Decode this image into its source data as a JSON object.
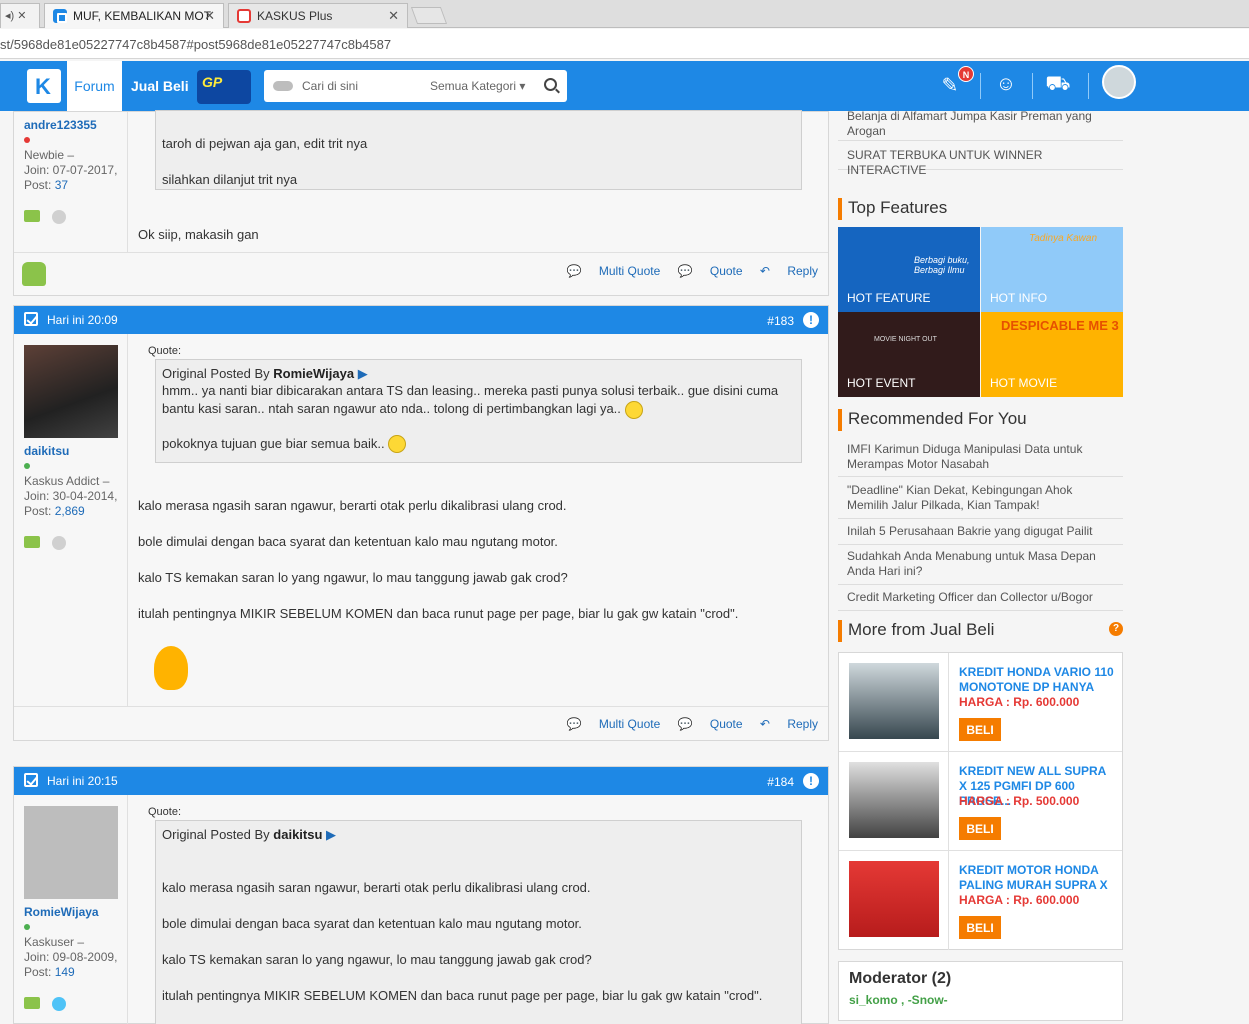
{
  "browser": {
    "tabs": [
      {
        "label": "MUF, KEMBALIKAN MOT"
      },
      {
        "label": "KASKUS Plus"
      }
    ],
    "stub": "◂) ✕",
    "url": "st/5968de81e05227747c8b4587#post5968de81e05227747c8b4587"
  },
  "header": {
    "nav_forum": "Forum",
    "nav_jualbeli": "Jual Beli",
    "gp": "GP",
    "search_placeholder": "Cari di sini",
    "search_category": "Semua Kategori",
    "notif_badge": "N"
  },
  "posts": {
    "p182": {
      "user": {
        "name": "andre123355",
        "rank": "Newbie –",
        "join": "Join: 07-07-2017,",
        "post_label": "Post: ",
        "post_count": "37"
      },
      "quote_lines": [
        "taroh di pejwan aja gan, edit trit nya",
        "silahkan dilanjut trit nya"
      ],
      "body": "Ok siip, makasih gan"
    },
    "p183": {
      "date": "Hari ini 20:09",
      "number": "#183",
      "user": {
        "name": "daikitsu",
        "rank": "Kaskus Addict –",
        "join": "Join: 30-04-2014,",
        "post_label": "Post: ",
        "post_count": "2,869"
      },
      "quote_label": "Quote:",
      "quote_prefix": "Original Posted By ",
      "quote_author": "RomieWijaya",
      "quote_text1": "hmm.. ya nanti biar dibicarakan antara TS dan leasing.. mereka pasti punya solusi terbaik.. gue disini cuma bantu kasi saran.. ntah saran ngawur ato nda.. tolong di pertimbangkan lagi ya..",
      "quote_text2": "pokoknya tujuan gue biar semua baik..",
      "body": [
        "kalo merasa ngasih saran ngawur, berarti otak perlu dikalibrasi ulang crod.",
        "bole dimulai dengan baca syarat dan ketentuan kalo mau ngutang motor.",
        "kalo TS kemakan saran lo yang ngawur, lo mau tanggung jawab gak crod?",
        "itulah pentingnya MIKIR SEBELUM KOMEN dan baca runut page per page, biar lu gak gw katain \"crod\"."
      ]
    },
    "p184": {
      "date": "Hari ini 20:15",
      "number": "#184",
      "user": {
        "name": "RomieWijaya",
        "rank": "Kaskuser –",
        "join": "Join: 09-08-2009,",
        "post_label": "Post: ",
        "post_count": "149"
      },
      "quote_label": "Quote:",
      "quote_prefix": "Original Posted By ",
      "quote_author": "daikitsu",
      "quote_lines": [
        "kalo merasa ngasih saran ngawur, berarti otak perlu dikalibrasi ulang crod.",
        "bole dimulai dengan baca syarat dan ketentuan kalo mau ngutang motor.",
        "kalo TS kemakan saran lo yang ngawur, lo mau tanggung jawab gak crod?",
        "itulah pentingnya MIKIR SEBELUM KOMEN dan baca runut page per page, biar lu gak gw katain \"crod\"."
      ]
    }
  },
  "actions": {
    "multi_quote": "Multi Quote",
    "quote": "Quote",
    "reply": "Reply"
  },
  "sidebar": {
    "top_links": [
      "Belanja di Alfamart Jumpa Kasir Preman yang Arogan",
      "SURAT TERBUKA UNTUK WINNER INTERACTIVE"
    ],
    "top_features_title": "Top Features",
    "features": [
      {
        "label": "HOT FEATURE",
        "art": "Berbagi buku, Berbagi Ilmu",
        "color": "#1565c0"
      },
      {
        "label": "HOT INFO",
        "art": "Tadinya Kawan",
        "color": "#90caf9"
      },
      {
        "label": "HOT EVENT",
        "art": "MOVIE NIGHT OUT",
        "color": "#311b1b"
      },
      {
        "label": "HOT MOVIE",
        "art": "DESPICABLE ME 3",
        "color": "#ffb300"
      }
    ],
    "recommended_title": "Recommended For You",
    "recommended": [
      "IMFI Karimun Diduga Manipulasi Data untuk Merampas Motor Nasabah",
      "\"Deadline\" Kian Dekat, Kebingungan Ahok Memilih Jalur Pilkada, Kian Tampak!",
      "Inilah 5 Perusahaan Bakrie yang digugat Pailit",
      "Sudahkah Anda Menabung untuk Masa Depan Anda Hari ini?",
      "Credit Marketing Officer dan Collector u/Bogor"
    ],
    "jualbeli_title": "More from Jual Beli",
    "jualbeli_items": [
      {
        "title": "KREDIT HONDA VARIO 110 MONOTONE DP HANYA",
        "price": "HARGA : Rp. 600.000",
        "buy": "BELI"
      },
      {
        "title": "KREDIT NEW ALL SUPRA X 125 PGMFI DP 600 PROSE...",
        "price": "HARGA : Rp. 500.000",
        "buy": "BELI"
      },
      {
        "title": "KREDIT MOTOR HONDA PALING MURAH SUPRA X",
        "price": "HARGA : Rp. 600.000",
        "buy": "BELI"
      }
    ],
    "moderator_title": "Moderator (2)",
    "moderators": "si_komo , -Snow-"
  }
}
